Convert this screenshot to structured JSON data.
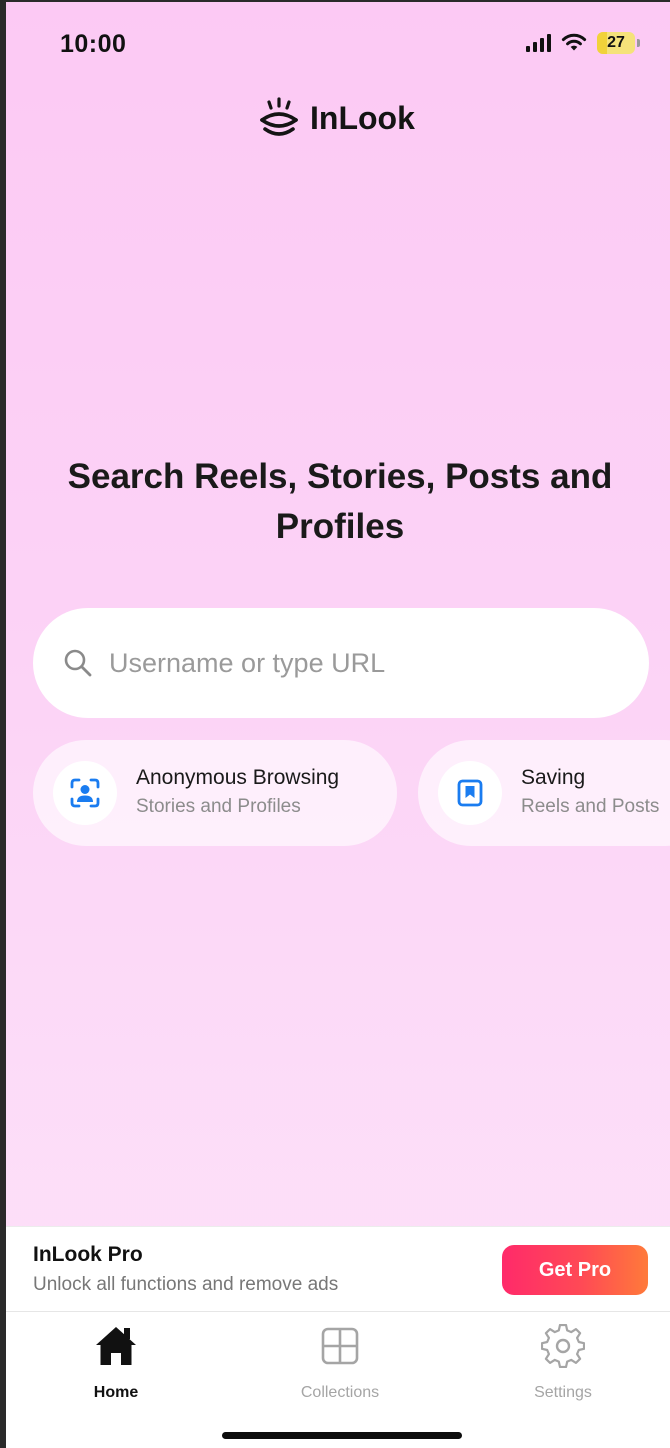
{
  "status_bar": {
    "time": "10:00",
    "battery": "27",
    "battery_level": 0.27,
    "icons": [
      "signal-icon",
      "wifi-icon",
      "battery-icon"
    ]
  },
  "app": {
    "name": "InLook",
    "logo_icon": "eye-logo-icon"
  },
  "headline": "Search Reels, Stories, Posts and Profiles",
  "search": {
    "placeholder": "Username or type URL",
    "value": "",
    "icon": "search-icon"
  },
  "features": [
    {
      "title": "Anonymous Browsing",
      "subtitle": "Stories and Profiles",
      "icon": "face-scan-icon"
    },
    {
      "title": "Saving",
      "subtitle": "Reels and Posts",
      "icon": "bookmark-icon"
    }
  ],
  "pro_banner": {
    "title": "InLook Pro",
    "subtitle": "Unlock all functions and remove ads",
    "button": "Get Pro"
  },
  "tabs": [
    {
      "label": "Home",
      "icon": "home-icon",
      "active": true
    },
    {
      "label": "Collections",
      "icon": "grid-icon",
      "active": false
    },
    {
      "label": "Settings",
      "icon": "gear-icon",
      "active": false
    }
  ],
  "colors": {
    "background_top": "#fcc9f4",
    "background_bottom": "#fde3f9",
    "accent_blue": "#1a7cf0",
    "pro_button_start": "#ff2a6a",
    "pro_button_end": "#ff7a3a"
  }
}
